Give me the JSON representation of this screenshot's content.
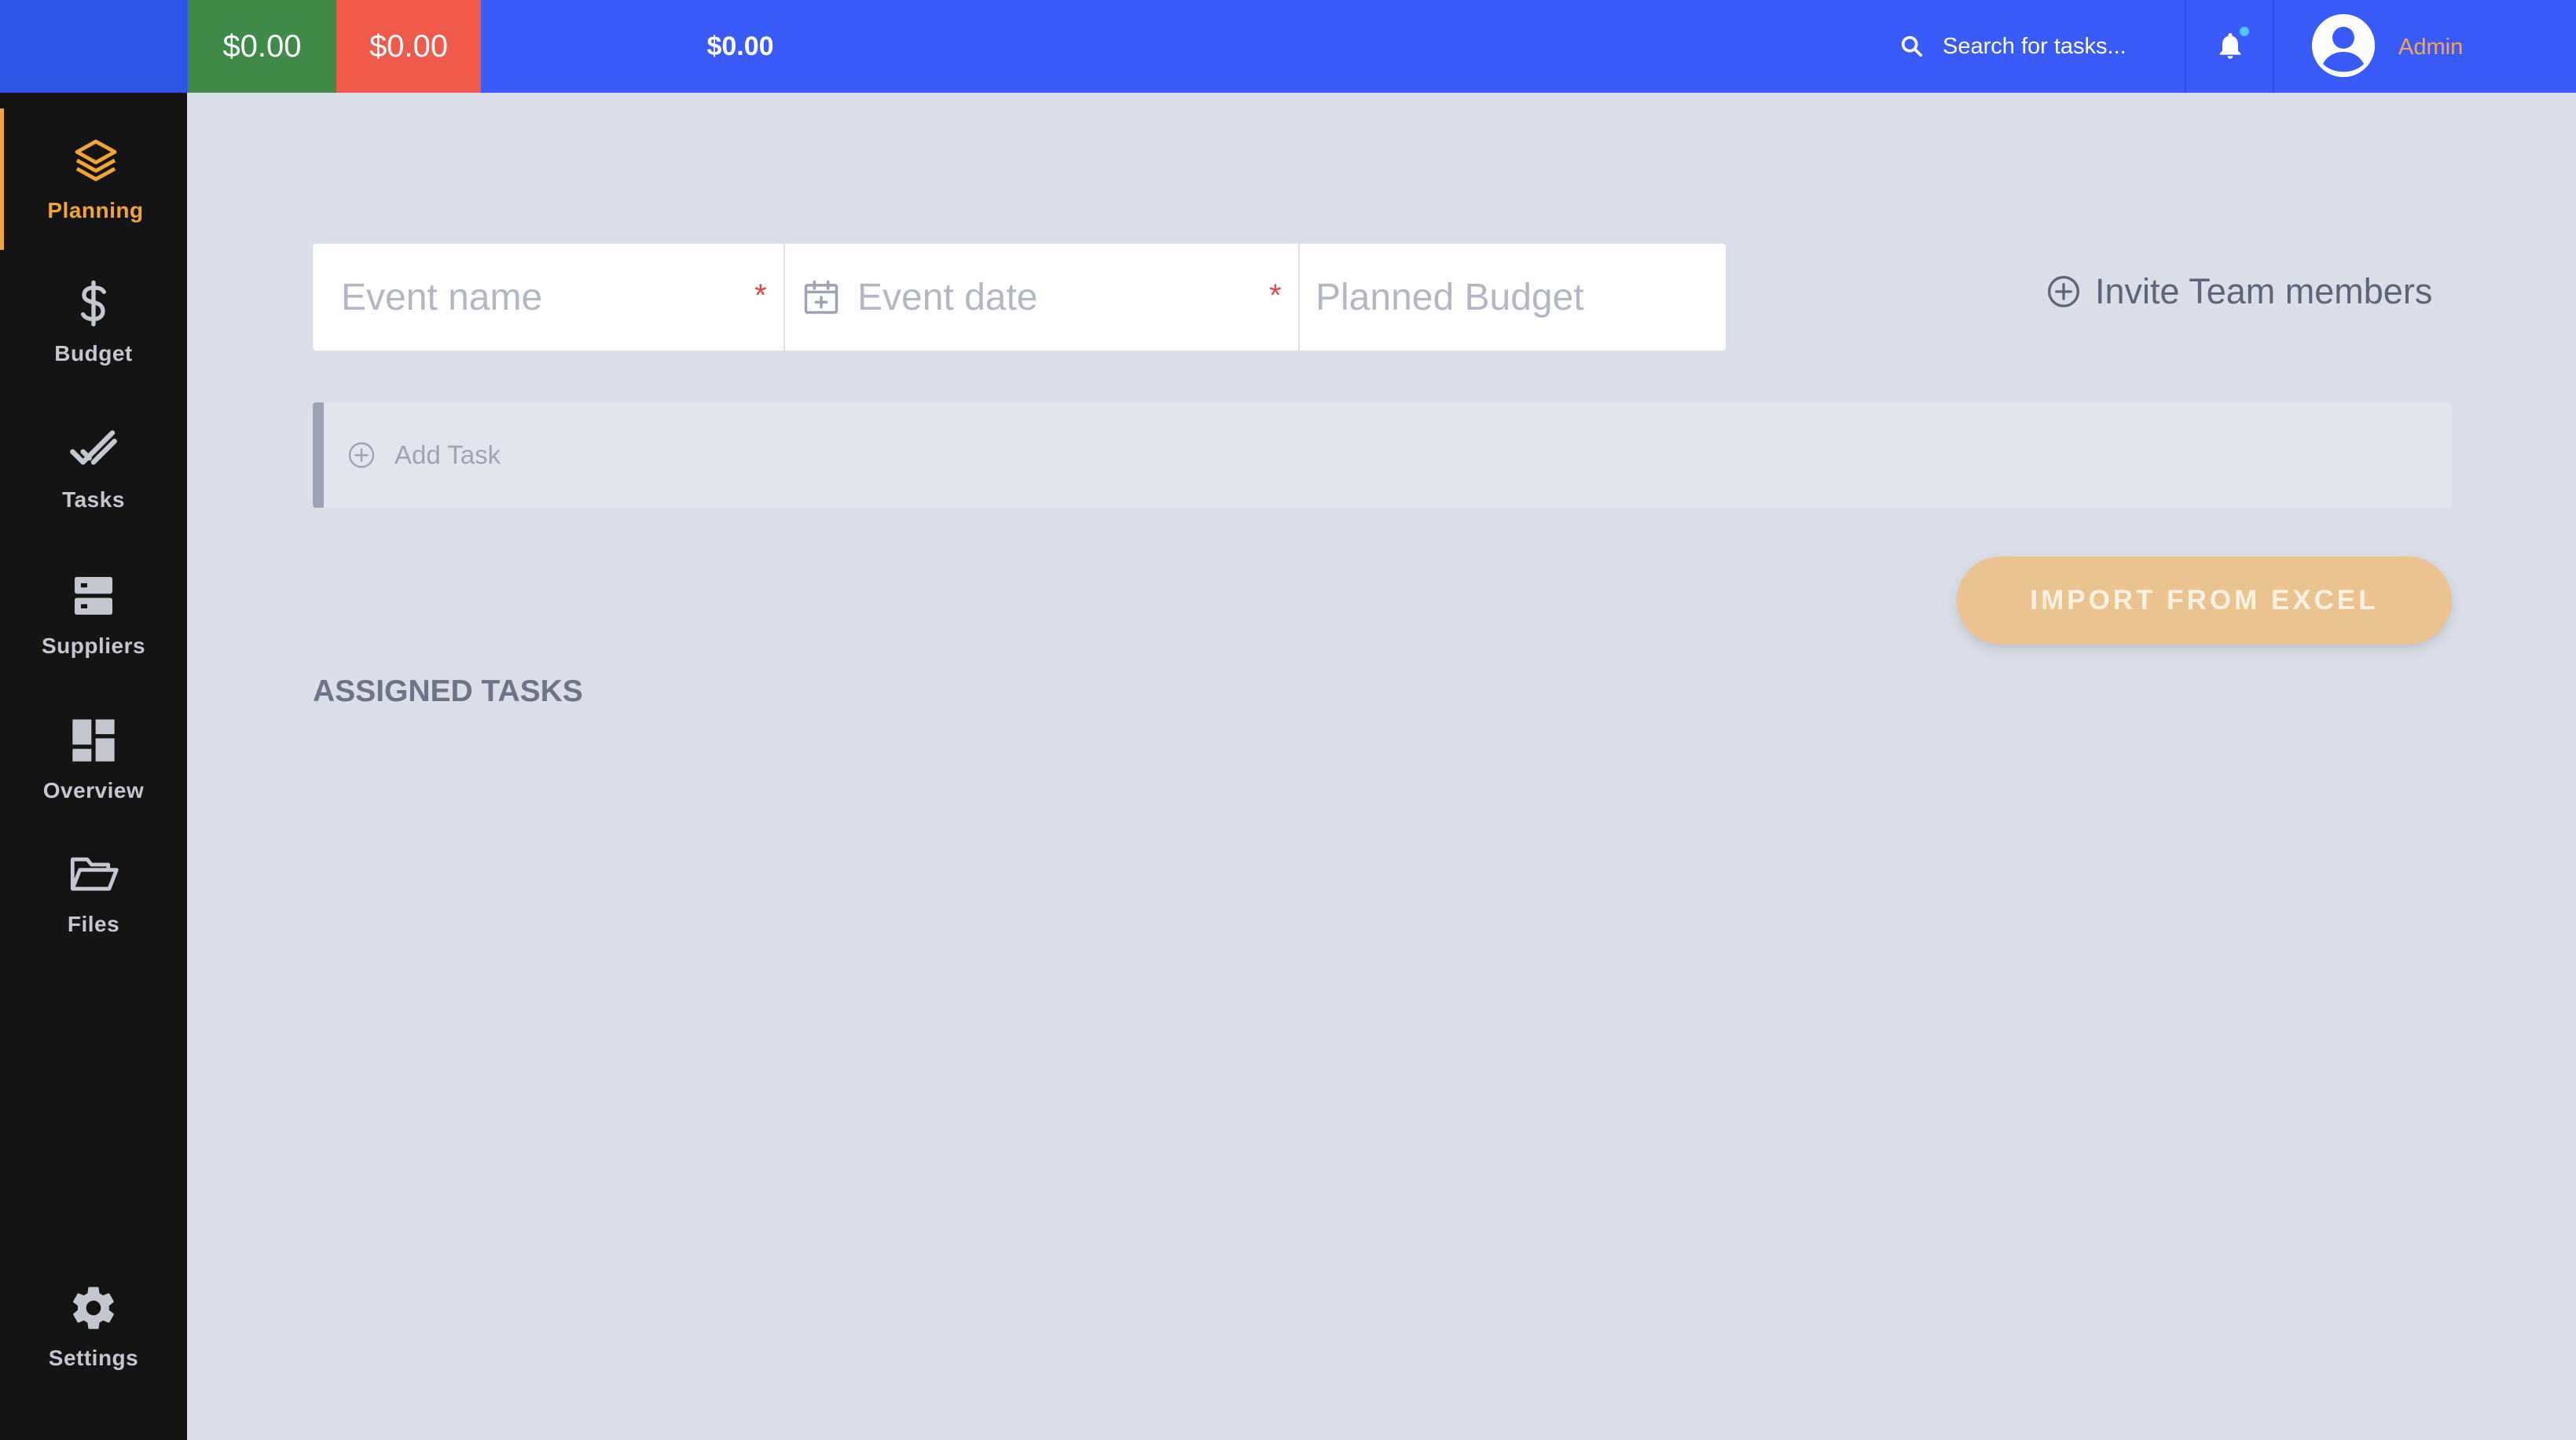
{
  "header": {
    "amounts": [
      "$0.00",
      "$0.00",
      "$0.00"
    ],
    "search_placeholder": "Search for tasks...",
    "user_name": "Admin"
  },
  "sidebar": {
    "items": [
      {
        "label": "Planning",
        "icon": "layers-icon"
      },
      {
        "label": "Budget",
        "icon": "dollar-icon"
      },
      {
        "label": "Tasks",
        "icon": "double-check-icon"
      },
      {
        "label": "Suppliers",
        "icon": "server-icon"
      },
      {
        "label": "Overview",
        "icon": "dashboard-icon"
      },
      {
        "label": "Files",
        "icon": "folder-open-icon"
      },
      {
        "label": "Settings",
        "icon": "gear-icon"
      }
    ]
  },
  "form": {
    "event_name_placeholder": "Event name",
    "event_date_placeholder": "Event date",
    "planned_budget_placeholder": "Planned Budget",
    "required_mark": "*"
  },
  "actions": {
    "invite_label": "Invite Team members",
    "add_task_label": "Add Task",
    "import_label": "IMPORT FROM EXCEL"
  },
  "sections": {
    "assigned_title": "ASSIGNED TASKS"
  },
  "colors": {
    "header_bg": "#3a5bfb",
    "sidebar_bg": "#141414",
    "accent": "#f2a33a",
    "income": "#3f8a47",
    "expense": "#ef5a4b",
    "import_button": "#eac391"
  }
}
